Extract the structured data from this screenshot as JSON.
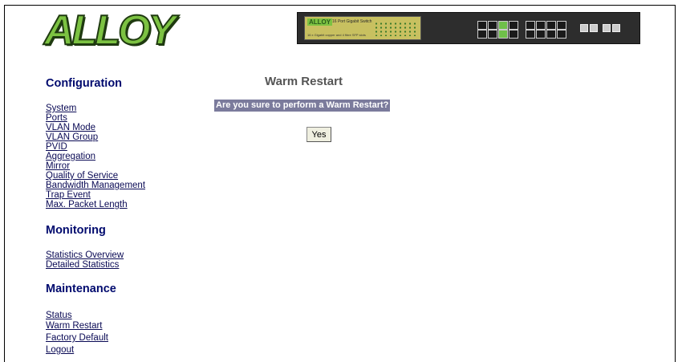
{
  "logo": {
    "text": "ALLOY"
  },
  "switch_image": {
    "brand": "ALLOY",
    "model": "16 Port Gigabit Switch",
    "subtitle": "16 x Gigabit copper and 4 fibre SFP slots"
  },
  "sidebar": {
    "configuration": {
      "heading": "Configuration",
      "items": [
        "System",
        "Ports",
        "VLAN Mode",
        "VLAN Group",
        "PVID",
        "Aggregation",
        "Mirror",
        "Quality of Service",
        "Bandwidth Management",
        "Trap Event",
        "Max. Packet Length"
      ]
    },
    "monitoring": {
      "heading": "Monitoring",
      "items": [
        "Statistics Overview",
        "Detailed Statistics"
      ]
    },
    "maintenance": {
      "heading": "Maintenance",
      "items": [
        "Status",
        "Warm Restart",
        "Factory Default",
        "Logout"
      ]
    }
  },
  "main": {
    "title": "Warm Restart",
    "question": "Are you sure to perform a Warm Restart?",
    "yes_label": "Yes"
  }
}
